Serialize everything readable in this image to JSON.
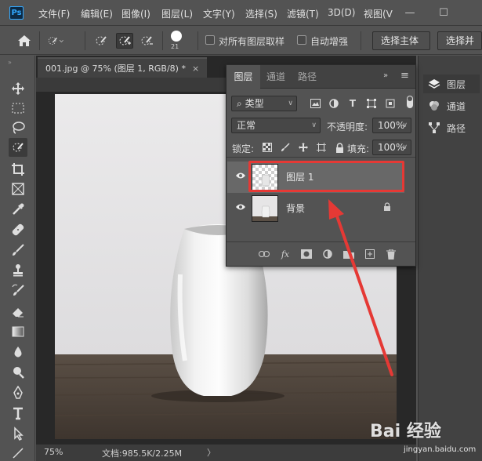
{
  "menu": {
    "logo": "Ps",
    "items": [
      "文件(F)",
      "编辑(E)",
      "图像(I)",
      "图层(L)",
      "文字(Y)",
      "选择(S)",
      "滤镜(T)",
      "3D(D)",
      "视图(V"
    ],
    "minimize": "—",
    "restore": "☐"
  },
  "options": {
    "brush_size": "21",
    "sample_all_layers": "对所有图层取样",
    "auto_enhance": "自动增强",
    "select_subject": "选择主体",
    "select_and_mask": "选择并"
  },
  "document": {
    "tab_title": "001.jpg @ 75% (图层 1, RGB/8) *",
    "tab_close": "×",
    "zoom": "75%",
    "doc_info": "文档:985.5K/2.25M",
    "status_arrow": "〉"
  },
  "layers_panel": {
    "tabs": [
      "图层",
      "通道",
      "路径"
    ],
    "filter_kind": "类型",
    "blend_mode": "正常",
    "opacity_label": "不透明度:",
    "opacity_value": "100%",
    "lock_label": "锁定:",
    "fill_label": "填充:",
    "fill_value": "100%",
    "layers": [
      {
        "name": "图层 1",
        "selected": true
      },
      {
        "name": "背景",
        "locked": true
      }
    ]
  },
  "dock": {
    "items": [
      "图层",
      "通道",
      "路径"
    ]
  },
  "watermark": {
    "brand": "Bai 经验",
    "url": "jingyan.baidu.com"
  },
  "colors": {
    "highlight": "#e53935",
    "ps_blue": "#31a8ff"
  }
}
